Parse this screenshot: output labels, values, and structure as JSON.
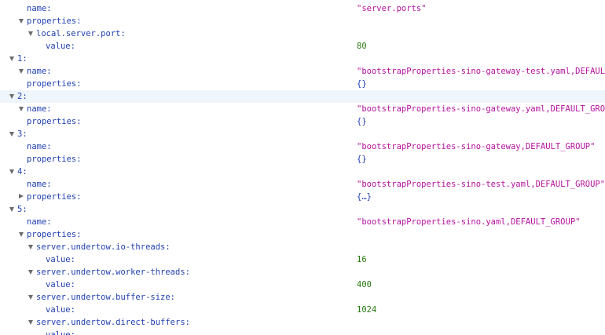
{
  "rows": [
    {
      "key": "name:",
      "value": "\"server.ports\"",
      "vtype": "str",
      "depth": 2,
      "twisty": "none"
    },
    {
      "key": "properties:",
      "value": "",
      "vtype": "",
      "depth": 1,
      "twisty": "expanded"
    },
    {
      "key": "local.server.port:",
      "value": "",
      "vtype": "",
      "depth": 2,
      "twisty": "expanded"
    },
    {
      "key": "value:",
      "value": "80",
      "vtype": "num",
      "depth": 3,
      "twisty": "none"
    },
    {
      "key": "1:",
      "value": "",
      "vtype": "",
      "depth": 0,
      "twisty": "expanded"
    },
    {
      "key": "name:",
      "value": "\"bootstrapProperties-sino-gateway-test.yaml,DEFAULT_GROUP\"",
      "vtype": "str",
      "depth": 1,
      "twisty": "expanded"
    },
    {
      "key": "properties:",
      "value": "{}",
      "vtype": "obj",
      "depth": 1,
      "twisty": "none"
    },
    {
      "key": "2:",
      "value": "",
      "vtype": "",
      "depth": 0,
      "twisty": "expanded",
      "highlight": true
    },
    {
      "key": "name:",
      "value": "\"bootstrapProperties-sino-gateway.yaml,DEFAULT_GROUP\"",
      "vtype": "str",
      "depth": 1,
      "twisty": "expanded"
    },
    {
      "key": "properties:",
      "value": "{}",
      "vtype": "obj",
      "depth": 1,
      "twisty": "none"
    },
    {
      "key": "3:",
      "value": "",
      "vtype": "",
      "depth": 0,
      "twisty": "expanded"
    },
    {
      "key": "name:",
      "value": "\"bootstrapProperties-sino-gateway,DEFAULT_GROUP\"",
      "vtype": "str",
      "depth": 1,
      "twisty": "none"
    },
    {
      "key": "properties:",
      "value": "{}",
      "vtype": "obj",
      "depth": 1,
      "twisty": "none"
    },
    {
      "key": "4:",
      "value": "",
      "vtype": "",
      "depth": 0,
      "twisty": "expanded"
    },
    {
      "key": "name:",
      "value": "\"bootstrapProperties-sino-test.yaml,DEFAULT_GROUP\"",
      "vtype": "str",
      "depth": 1,
      "twisty": "none"
    },
    {
      "key": "properties:",
      "value": "{…}",
      "vtype": "obj",
      "depth": 1,
      "twisty": "collapsed"
    },
    {
      "key": "5:",
      "value": "",
      "vtype": "",
      "depth": 0,
      "twisty": "expanded"
    },
    {
      "key": "name:",
      "value": "\"bootstrapProperties-sino.yaml,DEFAULT_GROUP\"",
      "vtype": "str",
      "depth": 1,
      "twisty": "none"
    },
    {
      "key": "properties:",
      "value": "",
      "vtype": "",
      "depth": 1,
      "twisty": "expanded"
    },
    {
      "key": "server.undertow.io-threads:",
      "value": "",
      "vtype": "",
      "depth": 2,
      "twisty": "expanded"
    },
    {
      "key": "value:",
      "value": "16",
      "vtype": "num",
      "depth": 3,
      "twisty": "none"
    },
    {
      "key": "server.undertow.worker-threads:",
      "value": "",
      "vtype": "",
      "depth": 2,
      "twisty": "expanded"
    },
    {
      "key": "value:",
      "value": "400",
      "vtype": "num",
      "depth": 3,
      "twisty": "none"
    },
    {
      "key": "server.undertow.buffer-size:",
      "value": "",
      "vtype": "",
      "depth": 2,
      "twisty": "expanded"
    },
    {
      "key": "value:",
      "value": "1024",
      "vtype": "num",
      "depth": 3,
      "twisty": "none"
    },
    {
      "key": "server.undertow.direct-buffers:",
      "value": "",
      "vtype": "",
      "depth": 2,
      "twisty": "expanded"
    },
    {
      "key": "value:",
      "value": "",
      "vtype": "",
      "depth": 3,
      "twisty": "none"
    }
  ]
}
